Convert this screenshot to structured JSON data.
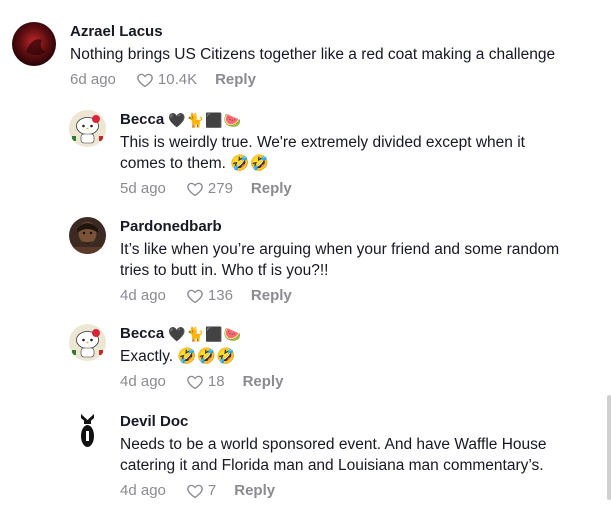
{
  "comments": [
    {
      "name": "Azrael Lacus",
      "badges": "",
      "text": "Nothing brings US Citizens together like a red coat making a challenge",
      "time": "6d ago",
      "likes": "10.4K",
      "reply": "Reply"
    },
    {
      "name": "Becca",
      "badges": "🖤🐈⬛🍉",
      "text": "This is weirdly true. We're extremely divided except when it comes to them. 🤣🤣",
      "time": "5d ago",
      "likes": "279",
      "reply": "Reply"
    },
    {
      "name": "Pardonedbarb",
      "badges": "",
      "text": "It’s like when you’re arguing when your friend and some random tries to butt in. Who tf is you?!!",
      "time": "4d ago",
      "likes": "136",
      "reply": "Reply"
    },
    {
      "name": "Becca",
      "badges": "🖤🐈⬛🍉",
      "text": "Exactly. 🤣🤣🤣",
      "time": "4d ago",
      "likes": "18",
      "reply": "Reply"
    },
    {
      "name": "Devil Doc",
      "badges": "",
      "text": "Needs to be a world sponsored event. And have Waffle House catering it and Florida man and Louisiana man commentary’s.",
      "time": "4d ago",
      "likes": "7",
      "reply": "Reply"
    }
  ]
}
